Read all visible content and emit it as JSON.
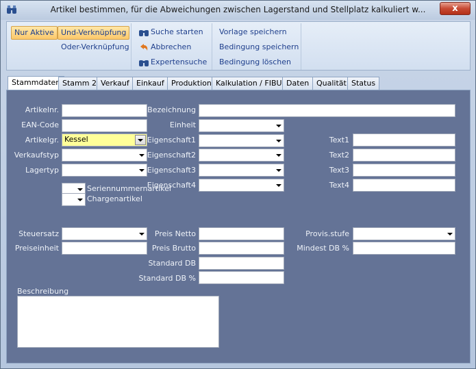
{
  "window": {
    "title": "Artikel bestimmen, für die Abweichungen zwischen Lagerstand und Stellplatz kalkuliert w...",
    "close_label": "x",
    "app_icon": "binoculars-icon"
  },
  "ribbon": {
    "filter": {
      "only_active": "Nur Aktive",
      "and_link": "Und-Verknüpfung",
      "or_link": "Oder-Verknüpfung"
    },
    "search": {
      "start": "Suche starten",
      "cancel": "Abbrechen",
      "expert": "Expertensuche"
    },
    "template": {
      "save_template": "Vorlage speichern",
      "save_condition": "Bedingung speichern",
      "delete_condition": "Bedingung löschen"
    }
  },
  "tabs": [
    "Stammdaten",
    "Stamm 2",
    "Verkauf",
    "Einkauf",
    "Produktion",
    "Kalkulation / FIBU",
    "Daten",
    "Qualität",
    "Status"
  ],
  "form": {
    "article_no": {
      "label": "Artikelnr.",
      "value": ""
    },
    "ean_code": {
      "label": "EAN-Code",
      "value": ""
    },
    "article_group": {
      "label": "Artikelgr.",
      "value": "Kessel"
    },
    "sales_type": {
      "label": "Verkaufstyp",
      "value": ""
    },
    "stock_type": {
      "label": "Lagertyp",
      "value": ""
    },
    "serial_article": {
      "label": "Seriennummernartikel"
    },
    "batch_article": {
      "label": "Chargenartikel"
    },
    "description_field": {
      "label": "Bezeichnung",
      "value": ""
    },
    "unit": {
      "label": "Einheit",
      "value": ""
    },
    "property1": {
      "label": "Eigenschaft1"
    },
    "property2": {
      "label": "Eigenschaft2"
    },
    "property3": {
      "label": "Eigenschaft3"
    },
    "property4": {
      "label": "Eigenschaft4"
    },
    "text1": {
      "label": "Text1",
      "value": ""
    },
    "text2": {
      "label": "Text2",
      "value": ""
    },
    "text3": {
      "label": "Text3",
      "value": ""
    },
    "text4": {
      "label": "Text4",
      "value": ""
    },
    "tax_rate": {
      "label": "Steuersatz"
    },
    "price_unit": {
      "label": "Preiseinheit",
      "value": ""
    },
    "price_net": {
      "label": "Preis Netto",
      "value": ""
    },
    "price_gross": {
      "label": "Preis Brutto",
      "value": ""
    },
    "standard_db": {
      "label": "Standard DB",
      "value": ""
    },
    "standard_db_pct": {
      "label": "Standard DB %",
      "value": ""
    },
    "commission_level": {
      "label": "Provis.stufe"
    },
    "min_db_pct": {
      "label": "Mindest DB %",
      "value": ""
    },
    "description": {
      "label": "Beschreibung",
      "value": ""
    }
  }
}
